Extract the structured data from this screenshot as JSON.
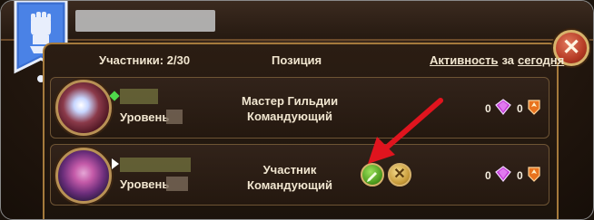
{
  "header": {
    "members_label": "Участники: 2/30",
    "position_label": "Позиция",
    "activity_label": "Активность",
    "activity_for": "за",
    "activity_period": "сегодня"
  },
  "close_icon": "close-icon",
  "members": [
    {
      "level_label": "Уровень",
      "role_primary": "Мастер Гильдии",
      "role_secondary": "Командующий",
      "stat_a": "0",
      "stat_b": "0",
      "has_edit_buttons": false
    },
    {
      "level_label": "Уровень",
      "role_primary": "Участник",
      "role_secondary": "Командующий",
      "stat_a": "0",
      "stat_b": "0",
      "has_edit_buttons": true
    }
  ],
  "colors": {
    "accent_gold": "#d7b36c",
    "close_red": "#b53b25",
    "edit_green": "#4c9a1d",
    "banner_blue": "#3b6fd1",
    "annotation_red": "#e0141e"
  }
}
